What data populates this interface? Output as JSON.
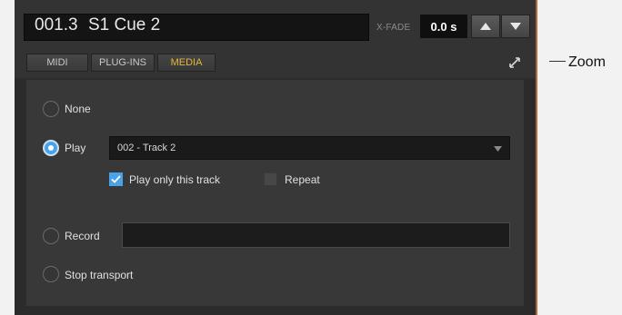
{
  "header": {
    "cue_number": "001.3",
    "cue_name": "S1 Cue 2",
    "xfade_label": "X-FADE",
    "xfade_value": "0.0 s"
  },
  "tabs": [
    {
      "label": "MIDI",
      "active": false
    },
    {
      "label": "PLUG-INS",
      "active": false
    },
    {
      "label": "MEDIA",
      "active": true
    }
  ],
  "options": {
    "none_label": "None",
    "play_label": "Play",
    "record_label": "Record",
    "stop_label": "Stop transport",
    "selected": "play"
  },
  "play": {
    "track_selected": "002 - Track 2",
    "play_only_label": "Play only this track",
    "play_only_checked": true,
    "repeat_label": "Repeat",
    "repeat_checked": false
  },
  "record": {
    "value": ""
  },
  "annotation": {
    "zoom_label": "Zoom"
  },
  "colors": {
    "accent": "#4aa3e8",
    "active_tab_text": "#e5b73a",
    "panel_border": "#b2683a"
  }
}
